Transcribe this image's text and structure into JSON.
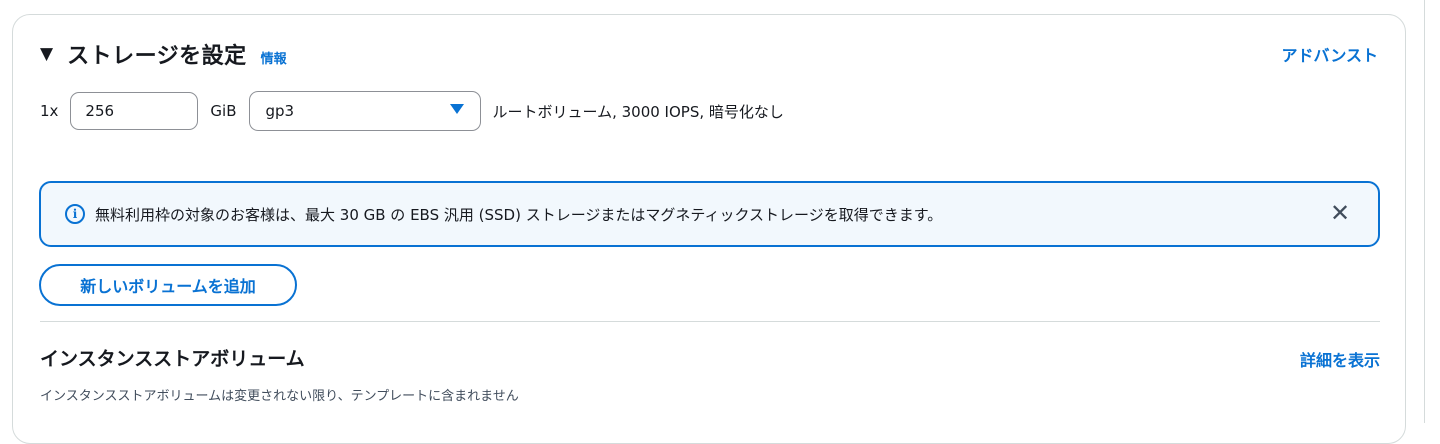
{
  "storage": {
    "title": "ストレージを設定",
    "info_link": "情報",
    "advanced_link": "アドバンスト",
    "volume": {
      "count": "1x",
      "size_value": "256",
      "unit": "GiB",
      "type_selected": "gp3",
      "description": "ルートボリューム,  3000 IOPS,  暗号化なし"
    },
    "alert": {
      "text": "無料利用枠の対象のお客様は、最大 30 GB の EBS 汎用 (SSD) ストレージまたはマグネティックストレージを取得できます。"
    },
    "add_volume_button": "新しいボリュームを追加"
  },
  "instance_store": {
    "title": "インスタンスストアボリューム",
    "detail_link": "詳細を表示",
    "description": "インスタンスストアボリュームは変更されない限り、テンプレートに含まれません"
  },
  "colors": {
    "accent": "#0972d3",
    "alert_bg": "#f2f8fd",
    "border": "#d5dbdb"
  }
}
